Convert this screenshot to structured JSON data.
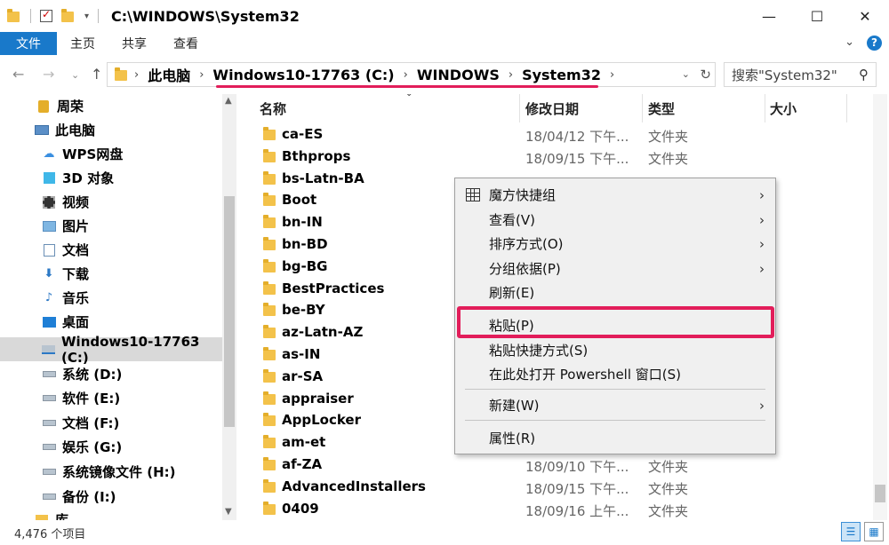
{
  "window": {
    "title": "C:\\WINDOWS\\System32",
    "controls": {
      "minimize": "—",
      "maximize": "☐",
      "close": "✕"
    }
  },
  "ribbon": {
    "tabs": [
      "文件",
      "主页",
      "共享",
      "查看"
    ],
    "expand": "⌄",
    "help": "?"
  },
  "nav": {
    "back": "←",
    "forward": "→",
    "recent": "⌄",
    "up": "↑",
    "breadcrumbs": [
      "此电脑",
      "Windows10-17763 (C:)",
      "WINDOWS",
      "System32"
    ],
    "search_placeholder": "搜索\"System32\""
  },
  "sidebar": {
    "items": [
      {
        "label": "周荣",
        "icon": "user-folder-icon"
      },
      {
        "label": "此电脑",
        "icon": "computer-icon"
      },
      {
        "label": "WPS网盘",
        "icon": "cloud-icon"
      },
      {
        "label": "3D 对象",
        "icon": "cube-icon"
      },
      {
        "label": "视频",
        "icon": "video-icon"
      },
      {
        "label": "图片",
        "icon": "picture-icon"
      },
      {
        "label": "文档",
        "icon": "document-icon"
      },
      {
        "label": "下载",
        "icon": "download-icon"
      },
      {
        "label": "音乐",
        "icon": "music-icon"
      },
      {
        "label": "桌面",
        "icon": "desktop-icon"
      },
      {
        "label": "Windows10-17763 (C:)",
        "icon": "windows-drive-icon",
        "selected": true
      },
      {
        "label": "系统 (D:)",
        "icon": "drive-icon"
      },
      {
        "label": "软件 (E:)",
        "icon": "drive-icon"
      },
      {
        "label": "文档 (F:)",
        "icon": "drive-icon"
      },
      {
        "label": "娱乐 (G:)",
        "icon": "drive-icon"
      },
      {
        "label": "系统镜像文件 (H:)",
        "icon": "drive-icon"
      },
      {
        "label": "备份 (I:)",
        "icon": "drive-icon"
      },
      {
        "label": "库",
        "icon": "library-icon"
      }
    ]
  },
  "list": {
    "columns": [
      "名称",
      "修改日期",
      "类型",
      "大小"
    ],
    "rows": [
      {
        "name": "ca-ES",
        "date": "18/04/12 下午...",
        "type": "文件夹"
      },
      {
        "name": "Bthprops",
        "date": "18/09/15 下午...",
        "type": "文件夹"
      },
      {
        "name": "bs-Latn-BA",
        "date": "",
        "type": ""
      },
      {
        "name": "Boot",
        "date": "",
        "type": ""
      },
      {
        "name": "bn-IN",
        "date": "",
        "type": ""
      },
      {
        "name": "bn-BD",
        "date": "",
        "type": ""
      },
      {
        "name": "bg-BG",
        "date": "",
        "type": ""
      },
      {
        "name": "BestPractices",
        "date": "",
        "type": ""
      },
      {
        "name": "be-BY",
        "date": "",
        "type": ""
      },
      {
        "name": "az-Latn-AZ",
        "date": "",
        "type": ""
      },
      {
        "name": "as-IN",
        "date": "",
        "type": ""
      },
      {
        "name": "ar-SA",
        "date": "",
        "type": ""
      },
      {
        "name": "appraiser",
        "date": "",
        "type": ""
      },
      {
        "name": "AppLocker",
        "date": "",
        "type": ""
      },
      {
        "name": "am-et",
        "date": "",
        "type": ""
      },
      {
        "name": "af-ZA",
        "date": "18/09/10 下午...",
        "type": "文件夹"
      },
      {
        "name": "AdvancedInstallers",
        "date": "18/09/15 下午...",
        "type": "文件夹"
      },
      {
        "name": "0409",
        "date": "18/09/16 上午...",
        "type": "文件夹"
      }
    ]
  },
  "context_menu": {
    "items": [
      {
        "label": "魔方快捷组",
        "submenu": true,
        "icon": "grid-icon"
      },
      {
        "label": "查看(V)",
        "submenu": true
      },
      {
        "label": "排序方式(O)",
        "submenu": true
      },
      {
        "label": "分组依据(P)",
        "submenu": true
      },
      {
        "label": "刷新(E)",
        "submenu": false
      },
      {
        "label": "粘贴(P)",
        "submenu": false,
        "highlighted": true
      },
      {
        "label": "粘贴快捷方式(S)",
        "submenu": false
      },
      {
        "label": "在此处打开 Powershell 窗口(S)",
        "submenu": false
      },
      {
        "label": "新建(W)",
        "submenu": true
      },
      {
        "label": "属性(R)",
        "submenu": false
      }
    ],
    "arrow": "›"
  },
  "status": {
    "item_count": "4,476 个项目"
  },
  "colors": {
    "accent": "#1979ca",
    "highlight": "#e21d5a",
    "folder": "#f3c24a"
  }
}
